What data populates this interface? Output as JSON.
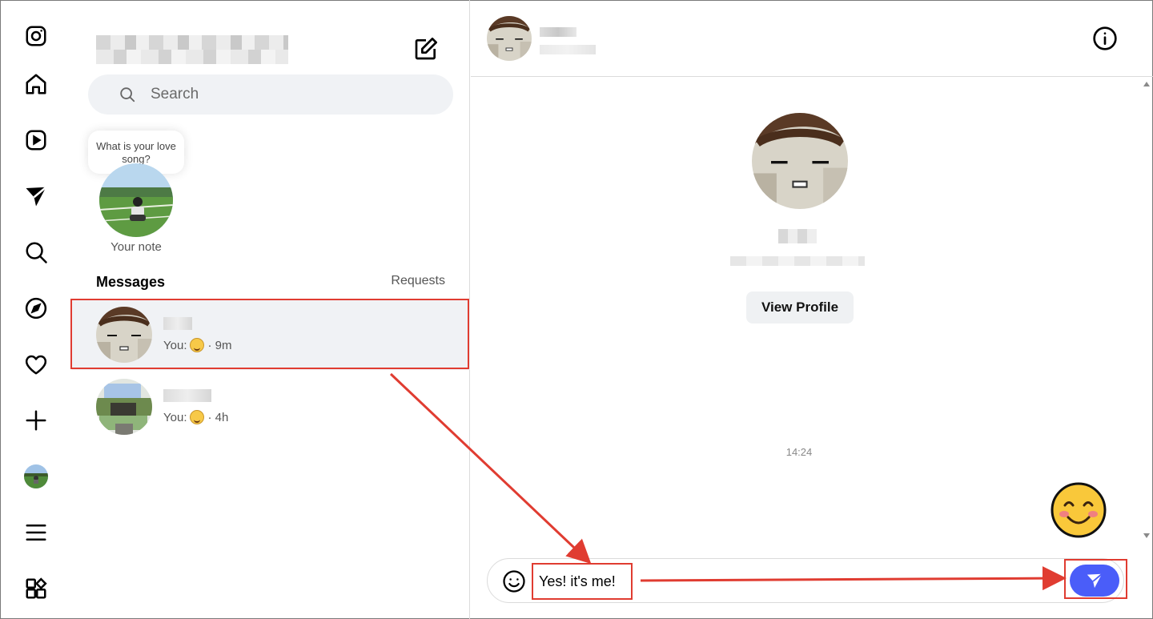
{
  "sidebar": {
    "items": [
      {
        "icon": "instagram-logo-icon"
      },
      {
        "icon": "home-icon"
      },
      {
        "icon": "reels-icon"
      },
      {
        "icon": "messages-icon"
      },
      {
        "icon": "search-icon"
      },
      {
        "icon": "explore-icon"
      },
      {
        "icon": "heart-icon"
      },
      {
        "icon": "plus-icon"
      },
      {
        "icon": "profile-avatar"
      },
      {
        "icon": "menu-icon"
      },
      {
        "icon": "apps-icon"
      }
    ]
  },
  "list": {
    "search_placeholder": "Search",
    "note_text": "What is your love song?",
    "note_label": "Your note",
    "messages_title": "Messages",
    "requests_label": "Requests",
    "conversations": [
      {
        "preview_prefix": "You:",
        "time": "· 9m"
      },
      {
        "preview_prefix": "You:",
        "time": "· 4h"
      }
    ]
  },
  "chat": {
    "view_profile_label": "View Profile",
    "timestamp": "14:24",
    "input_value": "Yes! it's me!"
  },
  "colors": {
    "accent": "#4a5df9",
    "annotation": "#e03c31",
    "active_row": "#f0f2f5"
  }
}
